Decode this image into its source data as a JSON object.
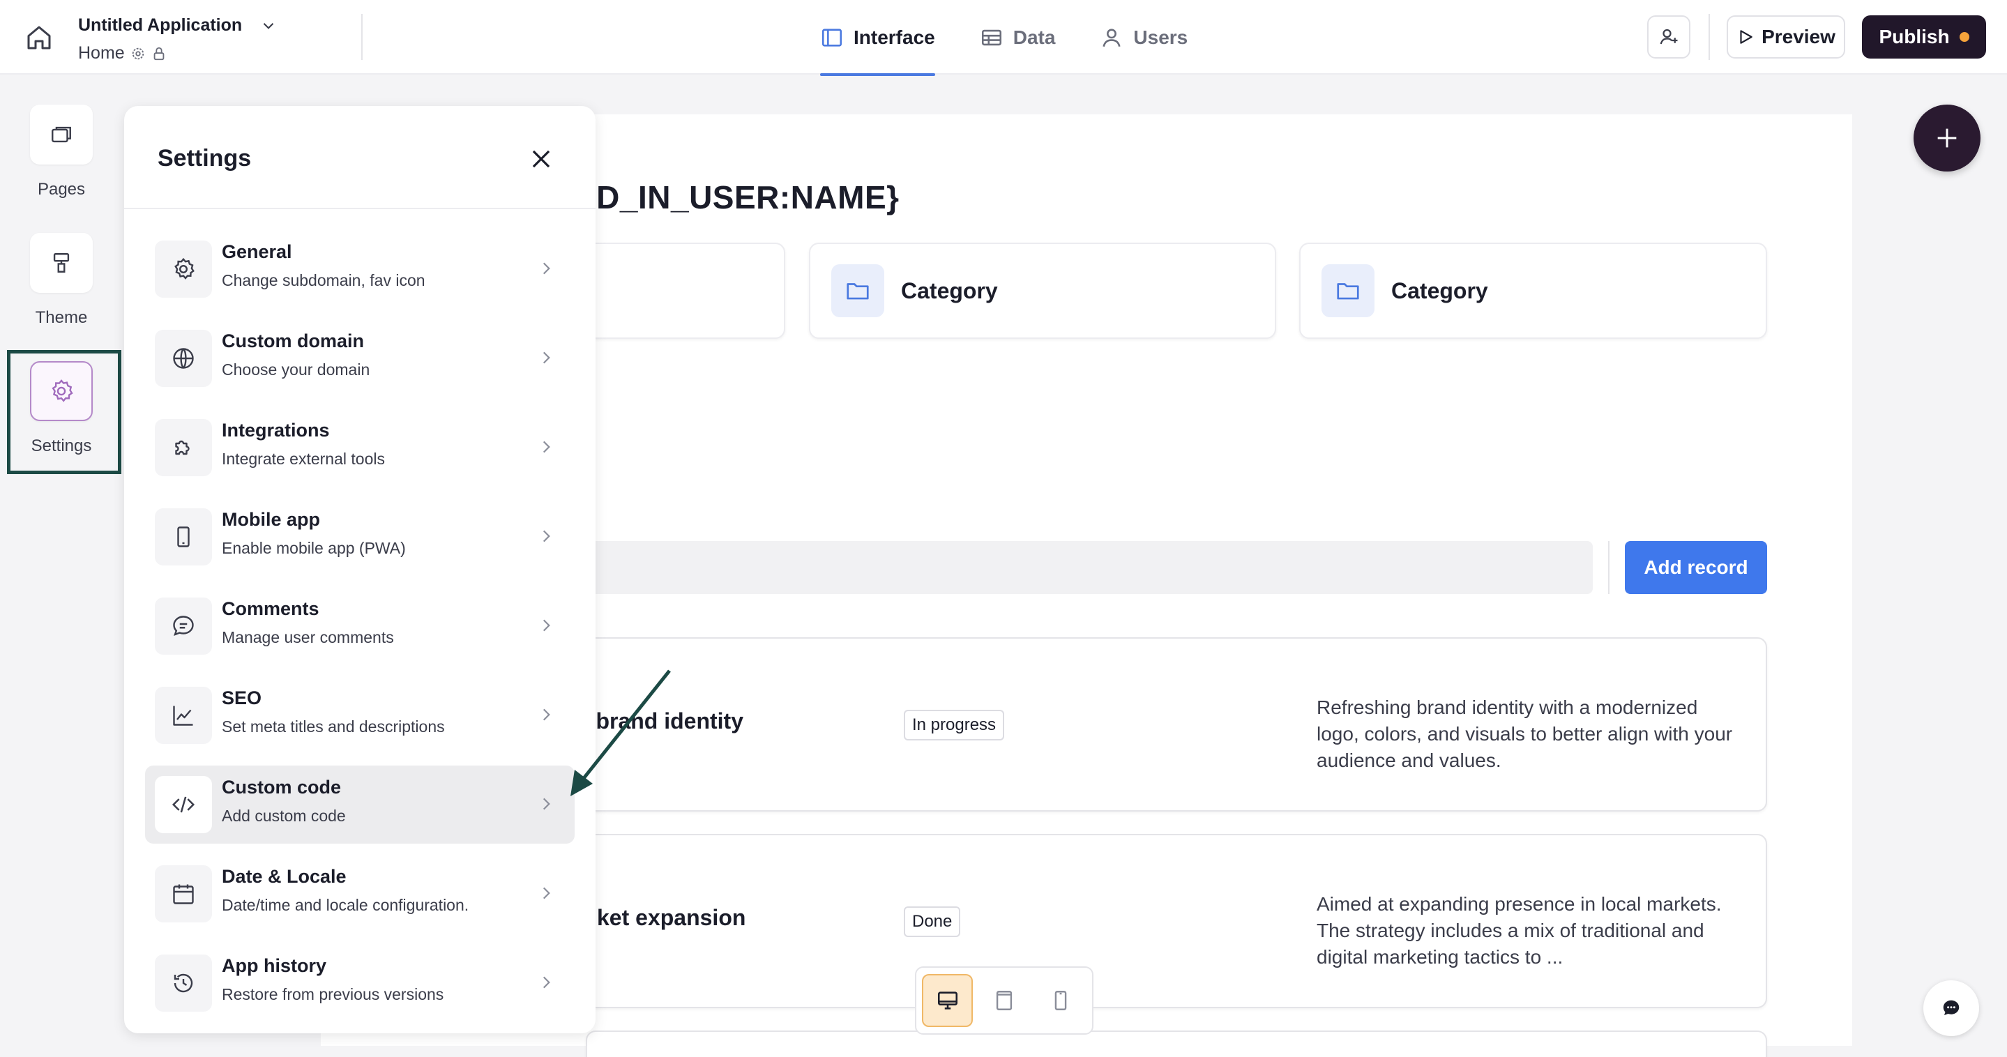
{
  "topbar": {
    "app_title": "Untitled Application",
    "breadcrumb": "Home",
    "tabs": [
      {
        "label": "Interface",
        "icon": "layout-icon",
        "active": true
      },
      {
        "label": "Data",
        "icon": "table-icon",
        "active": false
      },
      {
        "label": "Users",
        "icon": "user-icon",
        "active": false
      }
    ],
    "preview_label": "Preview",
    "publish_label": "Publish",
    "publish_dot_color": "#f5a33b"
  },
  "rail": {
    "items": [
      {
        "label": "Pages",
        "icon": "pages-icon"
      },
      {
        "label": "Theme",
        "icon": "paint-roller-icon"
      },
      {
        "label": "Settings",
        "icon": "gear-icon",
        "active": true
      }
    ]
  },
  "settings": {
    "title": "Settings",
    "items": [
      {
        "title": "General",
        "subtitle": "Change subdomain, fav icon",
        "icon": "gear-icon"
      },
      {
        "title": "Custom domain",
        "subtitle": "Choose your domain",
        "icon": "globe-icon"
      },
      {
        "title": "Integrations",
        "subtitle": "Integrate external tools",
        "icon": "puzzle-icon"
      },
      {
        "title": "Mobile app",
        "subtitle": "Enable mobile app (PWA)",
        "icon": "phone-icon"
      },
      {
        "title": "Comments",
        "subtitle": "Manage user comments",
        "icon": "chat-icon"
      },
      {
        "title": "SEO",
        "subtitle": "Set meta titles and descriptions",
        "icon": "chart-line-icon"
      },
      {
        "title": "Custom code",
        "subtitle": "Add custom code",
        "icon": "code-icon",
        "selected": true
      },
      {
        "title": "Date & Locale",
        "subtitle": "Date/time and locale configuration.",
        "icon": "calendar-icon"
      },
      {
        "title": "App history",
        "subtitle": "Restore from previous versions",
        "icon": "history-icon"
      }
    ]
  },
  "canvas": {
    "heading": "ED_IN_USER:NAME}",
    "categories": [
      "Category",
      "Category"
    ],
    "add_record_label": "Add record",
    "records": [
      {
        "title": "g brand identity",
        "status": "In progress",
        "description": "Refreshing brand identity with a modernized logo, colors, and visuals to better align with your audience and values."
      },
      {
        "title": "ket expansion",
        "status": "Done",
        "description": "Aimed at expanding presence in local markets. The strategy includes a mix of traditional and digital marketing tactics to ..."
      }
    ]
  },
  "colors": {
    "accent": "#4a79e0",
    "primary_button": "#3f78ec",
    "publish_bg": "#21172a",
    "highlight_border": "#1c4a45",
    "annotation_arrow": "#1c4a45"
  }
}
